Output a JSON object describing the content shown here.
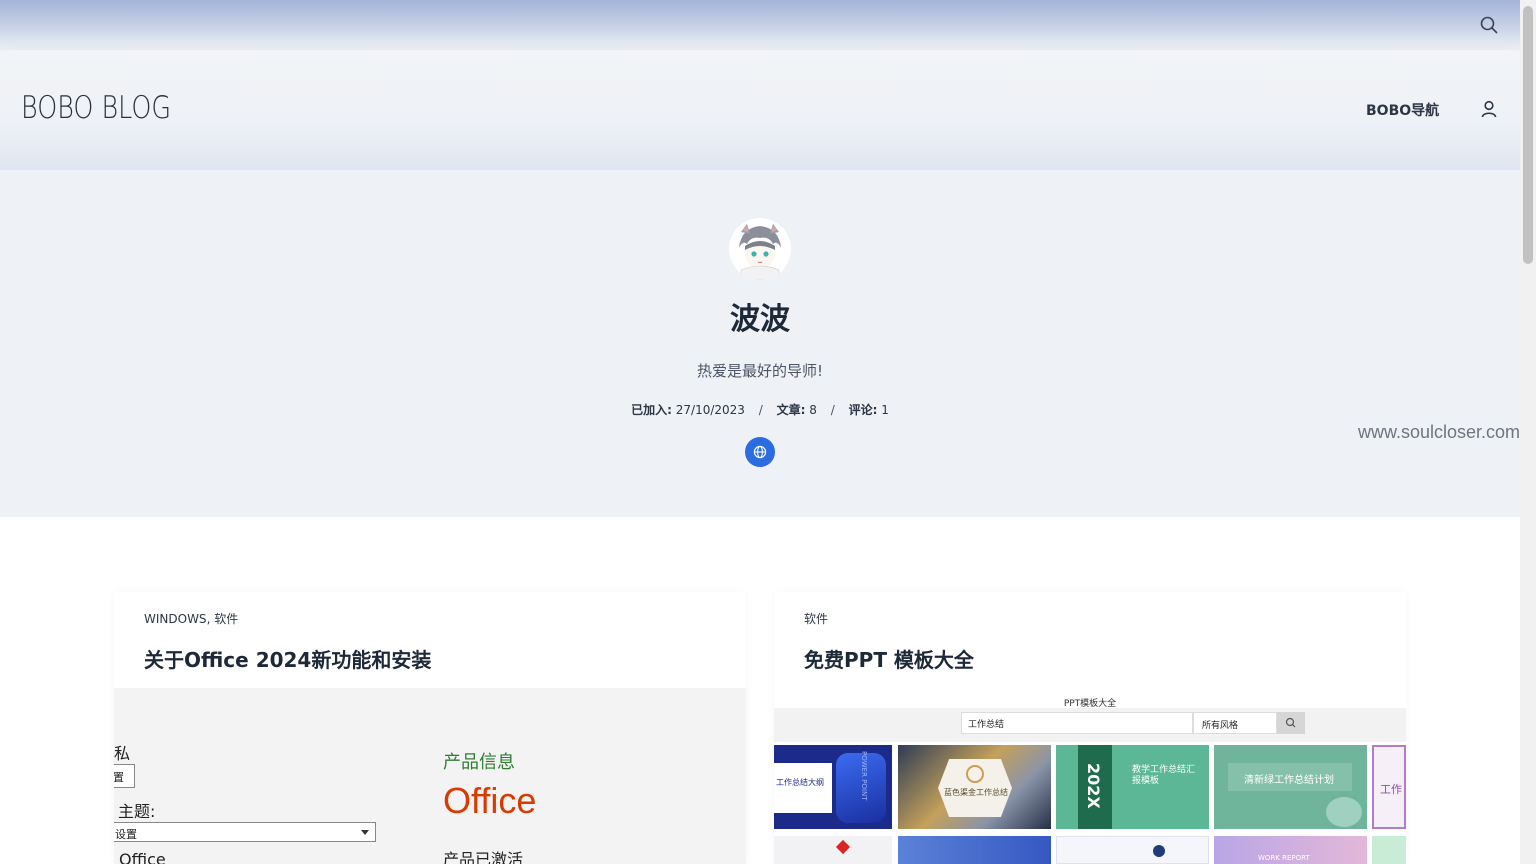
{
  "site": {
    "logo": "BOBO BLOG",
    "nav_link": "BOBO导航"
  },
  "author": {
    "name": "波波",
    "tagline": "热爱是最好的导师!",
    "joined_label": "已加入:",
    "joined_value": "27/10/2023",
    "posts_label": "文章:",
    "posts_value": "8",
    "comments_label": "评论:",
    "comments_value": "1",
    "separator": "/"
  },
  "watermark": "www.soulcloser.com",
  "posts": [
    {
      "categories": [
        "WINDOWS",
        "软件"
      ],
      "title": "关于Office 2024新功能和安装",
      "thumb_text": {
        "privacy": "私",
        "box": "置",
        "theme": "主题:",
        "dropdown": "设置",
        "office_small": "Office",
        "product_info": "产品信息",
        "office_logo": "Office",
        "activated": "产品已激活"
      }
    },
    {
      "categories": [
        "软件"
      ],
      "title": "免费PPT 模板大全",
      "thumb_text": {
        "page_title": "PPT模板大全",
        "search_value": "工作总结",
        "style_select": "所有风格",
        "tile_1": "工作总结大纲",
        "tile_1b": "POWER POINT",
        "tile_2": "蓝色渠金工作总结",
        "tile_3": "教学工作总结汇报模板",
        "tile_3b": "202X",
        "tile_4": "清新绿工作总结计划",
        "tile_5": "工作",
        "tile_6": "WORK REPORT"
      }
    }
  ],
  "colors": {
    "accent": "#2b6de0",
    "hero_bg": "#eef1f5",
    "office_orange": "#d83b01",
    "product_green": "#2e7d32"
  },
  "icons": {
    "search": "search-icon",
    "user": "user-icon",
    "globe": "globe-icon"
  }
}
